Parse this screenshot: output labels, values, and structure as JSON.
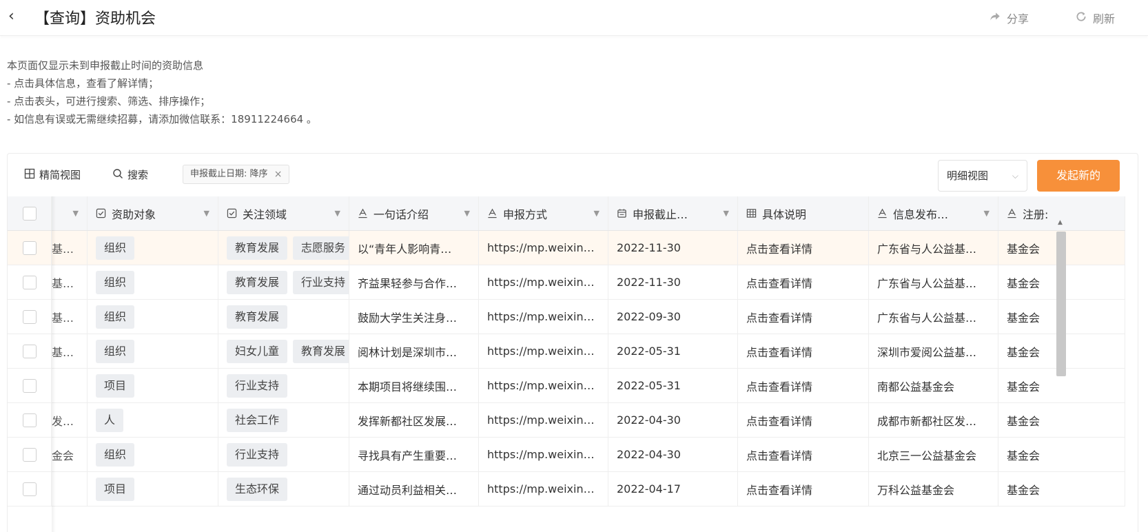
{
  "header": {
    "back_glyph": "‹",
    "title": "【查询】资助机会",
    "share_label": "分享",
    "refresh_label": "刷新"
  },
  "notes": [
    "本页面仅显示未到申报截止时间的资助信息",
    "- 点击具体信息，查看了解详情；",
    "- 点击表头，可进行搜索、筛选、排序操作；",
    "- 如信息有误或无需继续招募，请添加微信联系：18911224664 。"
  ],
  "toolbar": {
    "simple_view_label": "精简视图",
    "search_label": "搜索",
    "sort_tag": "申报截止日期: 降序",
    "view_select_value": "明细视图",
    "primary_button": "发起新的"
  },
  "columns": [
    {
      "label": "",
      "icon": "none"
    },
    {
      "label": "资助对象",
      "icon": "checkbox-icon"
    },
    {
      "label": "关注领域",
      "icon": "checkbox-icon"
    },
    {
      "label": "一句话介绍",
      "icon": "text-icon"
    },
    {
      "label": "申报方式",
      "icon": "text-icon"
    },
    {
      "label": "申报截止…",
      "icon": "calendar-icon"
    },
    {
      "label": "具体说明",
      "icon": "grid-icon"
    },
    {
      "label": "信息发布…",
      "icon": "text-icon"
    },
    {
      "label": "注册:",
      "icon": "text-icon"
    }
  ],
  "rows": [
    {
      "name": "基…",
      "target": [
        "组织"
      ],
      "areas": [
        "教育发展",
        "志愿服务"
      ],
      "intro": "以“青年人影响青…",
      "method": "https://mp.weixin…",
      "deadline": "2022-11-30",
      "detail": "点击查看详情",
      "publisher": "广东省与人公益基…",
      "reg": "基金会"
    },
    {
      "name": "基…",
      "target": [
        "组织"
      ],
      "areas": [
        "教育发展",
        "行业支持"
      ],
      "intro": "齐益果轻参与合作…",
      "method": "https://mp.weixin…",
      "deadline": "2022-11-30",
      "detail": "点击查看详情",
      "publisher": "广东省与人公益基…",
      "reg": "基金会"
    },
    {
      "name": "基…",
      "target": [
        "组织"
      ],
      "areas": [
        "教育发展"
      ],
      "intro": "鼓励大学生关注身…",
      "method": "https://mp.weixin…",
      "deadline": "2022-09-30",
      "detail": "点击查看详情",
      "publisher": "广东省与人公益基…",
      "reg": "基金会"
    },
    {
      "name": "基…",
      "target": [
        "组织"
      ],
      "areas": [
        "妇女儿童",
        "教育发展"
      ],
      "intro": "阅林计划是深圳市…",
      "method": "https://mp.weixin…",
      "deadline": "2022-05-31",
      "detail": "点击查看详情",
      "publisher": "深圳市爱阅公益基…",
      "reg": "基金会"
    },
    {
      "name": "",
      "target": [
        "项目"
      ],
      "areas": [
        "行业支持"
      ],
      "intro": "本期项目将继续围…",
      "method": "https://mp.weixin…",
      "deadline": "2022-05-31",
      "detail": "点击查看详情",
      "publisher": "南都公益基金会",
      "reg": "基金会"
    },
    {
      "name": "发…",
      "target": [
        "人"
      ],
      "areas": [
        "社会工作"
      ],
      "intro": "发挥新都社区发展…",
      "method": "https://mp.weixin…",
      "deadline": "2022-04-30",
      "detail": "点击查看详情",
      "publisher": "成都市新都社区发…",
      "reg": "基金会"
    },
    {
      "name": "金会",
      "target": [
        "组织"
      ],
      "areas": [
        "行业支持"
      ],
      "intro": "寻找具有产生重要…",
      "method": "https://mp.weixin…",
      "deadline": "2022-04-30",
      "detail": "点击查看详情",
      "publisher": "北京三一公益基金会",
      "reg": "基金会"
    },
    {
      "name": "",
      "target": [
        "项目"
      ],
      "areas": [
        "生态环保"
      ],
      "intro": "通过动员利益相关…",
      "method": "https://mp.weixin…",
      "deadline": "2022-04-17",
      "detail": "点击查看详情",
      "publisher": "万科公益基金会",
      "reg": "基金会"
    }
  ],
  "colors": {
    "accent": "#f7903a",
    "highlight_row": "#fff8f0",
    "header_bg": "#f5f6f8",
    "chip_bg": "#eceef1"
  }
}
